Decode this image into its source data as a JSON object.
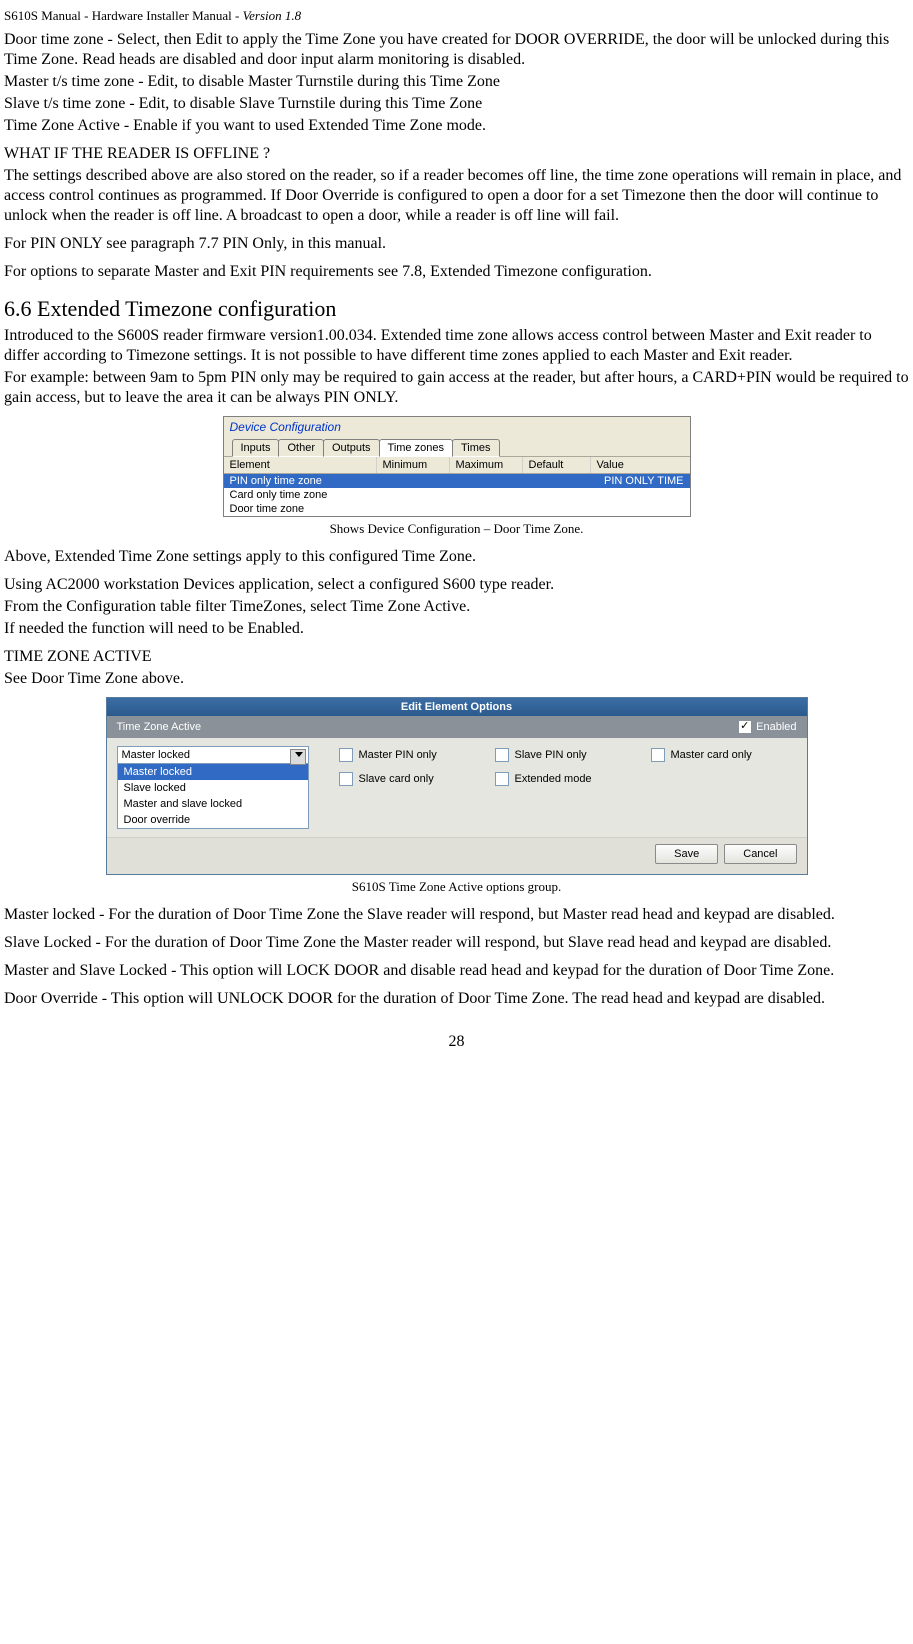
{
  "header": {
    "left": "S610S Manual  - Hardware Installer Manual  - ",
    "version": "Version 1.8"
  },
  "p1": {
    "label": "Door time zone",
    "sep": " -  Select, then ",
    "edit": "Edit",
    "rest": " to apply the Time Zone you have created for DOOR OVERRIDE, the door will be unlocked during this Time Zone.  Read heads are disabled and door input alarm monitoring is disabled."
  },
  "p2": {
    "label": "Master t/s time zone",
    "rest": " -  Edit, to disable Master Turnstile during this Time Zone"
  },
  "p3": {
    "label": "Slave t/s time zone",
    "rest": " - Edit, to disable Slave Turnstile during this Time Zone"
  },
  "p4": {
    "label": "Time Zone Active",
    "rest": " -  Enable if you want to used Extended Time Zone mode."
  },
  "p5": {
    "h": "WHAT IF THE READER IS OFFLINE ?",
    "body": "The settings described above are also stored on the reader, so if a reader becomes off line, the time zone operations will remain in place, and access control continues as programmed.  If  Door Override is configured to open a door for a set Timezone then the door will continue to unlock when the reader is off line.  A broadcast to open a door, while a reader is off line will fail."
  },
  "p6": "For PIN ONLY see paragraph 7.7 PIN Only, in this manual.",
  "p7": "For options to separate Master and Exit PIN requirements see 7.8, Extended Timezone configuration.",
  "section": "6.6    Extended Timezone configuration",
  "p8": "Introduced to the S600S reader firmware version1.00.034.  Extended time zone allows access control between Master and Exit reader to differ according to Timezone settings.  It is not possible to have different time zones applied to each Master and Exit reader.",
  "p8b": "For example: between 9am to 5pm PIN only may be required to gain access at the reader, but after hours, a CARD+PIN would be required to gain access, but to leave the area it can be always PIN ONLY.",
  "fig1": {
    "title": "Device Configuration",
    "tabs": [
      "Inputs",
      "Other",
      "Outputs",
      "Time zones",
      "Times"
    ],
    "cols": [
      "Element",
      "Minimum",
      "Maximum",
      "Default",
      "Value"
    ],
    "rows": [
      {
        "left": "PIN only time zone",
        "right": "PIN ONLY TIME",
        "sel": true
      },
      {
        "left": "Card only time zone",
        "right": "",
        "sel": false
      },
      {
        "left": "Door time zone",
        "right": "",
        "sel": false
      }
    ],
    "caption": "Shows  Device Configuration – Door Time Zone."
  },
  "p9": "Above, Extended Time Zone settings  apply to this configured Time Zone.",
  "p10": {
    "a": "Using AC2000 workstation Devices application, select a configured S600 type reader.",
    "b_pre": "From the ",
    "b_conf": "Configuration",
    "b_mid": " table filter ",
    "b_tz": "TimeZones",
    "b_sel": ", select ",
    "b_tza": "Time Zone Active",
    "b_dot": ".",
    "c_pre": "If needed the function will need to be ",
    "c_en": "Enabled",
    "c_dot": "."
  },
  "p11": {
    "h": "TIME ZONE ACTIVE",
    "see_pre": "See ",
    "see_dtz": "Door Time Zone",
    "see_post": " above."
  },
  "fig2": {
    "title": "Edit Element Options",
    "bar_label": "Time Zone Active",
    "enabled": "Enabled",
    "selected": "Master locked",
    "options": [
      "Master locked",
      "Slave locked",
      "Master and slave locked",
      "Door override"
    ],
    "checks": [
      "Master PIN only",
      "Slave PIN only",
      "Master card only",
      "Slave card only",
      "Extended mode"
    ],
    "save": "Save",
    "cancel": "Cancel",
    "caption": "S610S Time Zone Active options group."
  },
  "p12": {
    "label": "Master locked",
    "rest": " -  For the duration of Door Time Zone the Slave reader will respond, but Master read head and keypad are disabled."
  },
  "p13": {
    "label": "Slave Locked",
    "rest": " -  For the duration of Door Time Zone the Master reader will respond, but Slave read head and keypad are disabled."
  },
  "p14": {
    "label": "Master and Slave Locked",
    "rest": " -  This option will LOCK DOOR and disable read head and keypad for the duration of Door Time Zone."
  },
  "p15": {
    "label": "Door Override",
    "rest": " -  This option will UNLOCK DOOR for the duration of Door Time Zone.  The read head and keypad are disabled."
  },
  "page": "28"
}
